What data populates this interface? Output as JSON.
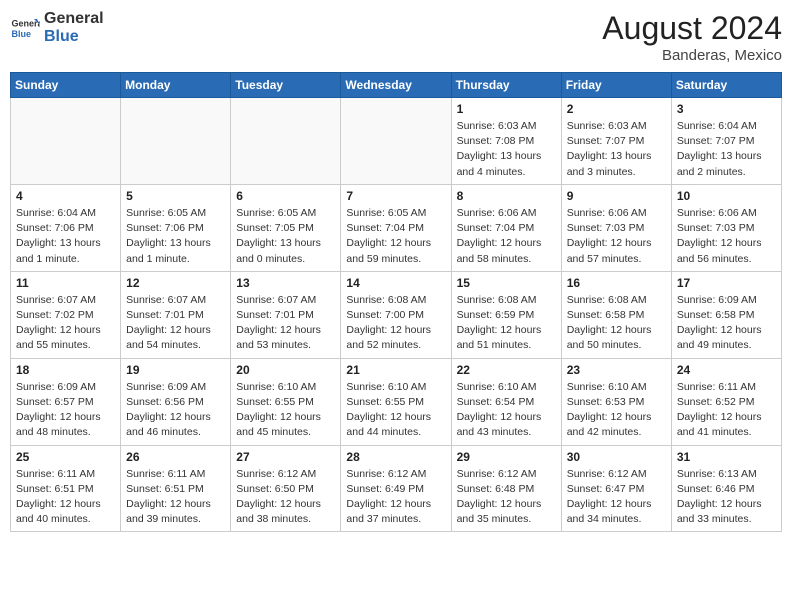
{
  "header": {
    "logo_general": "General",
    "logo_blue": "Blue",
    "month_year": "August 2024",
    "location": "Banderas, Mexico"
  },
  "days_of_week": [
    "Sunday",
    "Monday",
    "Tuesday",
    "Wednesday",
    "Thursday",
    "Friday",
    "Saturday"
  ],
  "weeks": [
    [
      {
        "day": "",
        "info": ""
      },
      {
        "day": "",
        "info": ""
      },
      {
        "day": "",
        "info": ""
      },
      {
        "day": "",
        "info": ""
      },
      {
        "day": "1",
        "info": "Sunrise: 6:03 AM\nSunset: 7:08 PM\nDaylight: 13 hours\nand 4 minutes."
      },
      {
        "day": "2",
        "info": "Sunrise: 6:03 AM\nSunset: 7:07 PM\nDaylight: 13 hours\nand 3 minutes."
      },
      {
        "day": "3",
        "info": "Sunrise: 6:04 AM\nSunset: 7:07 PM\nDaylight: 13 hours\nand 2 minutes."
      }
    ],
    [
      {
        "day": "4",
        "info": "Sunrise: 6:04 AM\nSunset: 7:06 PM\nDaylight: 13 hours\nand 1 minute."
      },
      {
        "day": "5",
        "info": "Sunrise: 6:05 AM\nSunset: 7:06 PM\nDaylight: 13 hours\nand 1 minute."
      },
      {
        "day": "6",
        "info": "Sunrise: 6:05 AM\nSunset: 7:05 PM\nDaylight: 13 hours\nand 0 minutes."
      },
      {
        "day": "7",
        "info": "Sunrise: 6:05 AM\nSunset: 7:04 PM\nDaylight: 12 hours\nand 59 minutes."
      },
      {
        "day": "8",
        "info": "Sunrise: 6:06 AM\nSunset: 7:04 PM\nDaylight: 12 hours\nand 58 minutes."
      },
      {
        "day": "9",
        "info": "Sunrise: 6:06 AM\nSunset: 7:03 PM\nDaylight: 12 hours\nand 57 minutes."
      },
      {
        "day": "10",
        "info": "Sunrise: 6:06 AM\nSunset: 7:03 PM\nDaylight: 12 hours\nand 56 minutes."
      }
    ],
    [
      {
        "day": "11",
        "info": "Sunrise: 6:07 AM\nSunset: 7:02 PM\nDaylight: 12 hours\nand 55 minutes."
      },
      {
        "day": "12",
        "info": "Sunrise: 6:07 AM\nSunset: 7:01 PM\nDaylight: 12 hours\nand 54 minutes."
      },
      {
        "day": "13",
        "info": "Sunrise: 6:07 AM\nSunset: 7:01 PM\nDaylight: 12 hours\nand 53 minutes."
      },
      {
        "day": "14",
        "info": "Sunrise: 6:08 AM\nSunset: 7:00 PM\nDaylight: 12 hours\nand 52 minutes."
      },
      {
        "day": "15",
        "info": "Sunrise: 6:08 AM\nSunset: 6:59 PM\nDaylight: 12 hours\nand 51 minutes."
      },
      {
        "day": "16",
        "info": "Sunrise: 6:08 AM\nSunset: 6:58 PM\nDaylight: 12 hours\nand 50 minutes."
      },
      {
        "day": "17",
        "info": "Sunrise: 6:09 AM\nSunset: 6:58 PM\nDaylight: 12 hours\nand 49 minutes."
      }
    ],
    [
      {
        "day": "18",
        "info": "Sunrise: 6:09 AM\nSunset: 6:57 PM\nDaylight: 12 hours\nand 48 minutes."
      },
      {
        "day": "19",
        "info": "Sunrise: 6:09 AM\nSunset: 6:56 PM\nDaylight: 12 hours\nand 46 minutes."
      },
      {
        "day": "20",
        "info": "Sunrise: 6:10 AM\nSunset: 6:55 PM\nDaylight: 12 hours\nand 45 minutes."
      },
      {
        "day": "21",
        "info": "Sunrise: 6:10 AM\nSunset: 6:55 PM\nDaylight: 12 hours\nand 44 minutes."
      },
      {
        "day": "22",
        "info": "Sunrise: 6:10 AM\nSunset: 6:54 PM\nDaylight: 12 hours\nand 43 minutes."
      },
      {
        "day": "23",
        "info": "Sunrise: 6:10 AM\nSunset: 6:53 PM\nDaylight: 12 hours\nand 42 minutes."
      },
      {
        "day": "24",
        "info": "Sunrise: 6:11 AM\nSunset: 6:52 PM\nDaylight: 12 hours\nand 41 minutes."
      }
    ],
    [
      {
        "day": "25",
        "info": "Sunrise: 6:11 AM\nSunset: 6:51 PM\nDaylight: 12 hours\nand 40 minutes."
      },
      {
        "day": "26",
        "info": "Sunrise: 6:11 AM\nSunset: 6:51 PM\nDaylight: 12 hours\nand 39 minutes."
      },
      {
        "day": "27",
        "info": "Sunrise: 6:12 AM\nSunset: 6:50 PM\nDaylight: 12 hours\nand 38 minutes."
      },
      {
        "day": "28",
        "info": "Sunrise: 6:12 AM\nSunset: 6:49 PM\nDaylight: 12 hours\nand 37 minutes."
      },
      {
        "day": "29",
        "info": "Sunrise: 6:12 AM\nSunset: 6:48 PM\nDaylight: 12 hours\nand 35 minutes."
      },
      {
        "day": "30",
        "info": "Sunrise: 6:12 AM\nSunset: 6:47 PM\nDaylight: 12 hours\nand 34 minutes."
      },
      {
        "day": "31",
        "info": "Sunrise: 6:13 AM\nSunset: 6:46 PM\nDaylight: 12 hours\nand 33 minutes."
      }
    ]
  ]
}
